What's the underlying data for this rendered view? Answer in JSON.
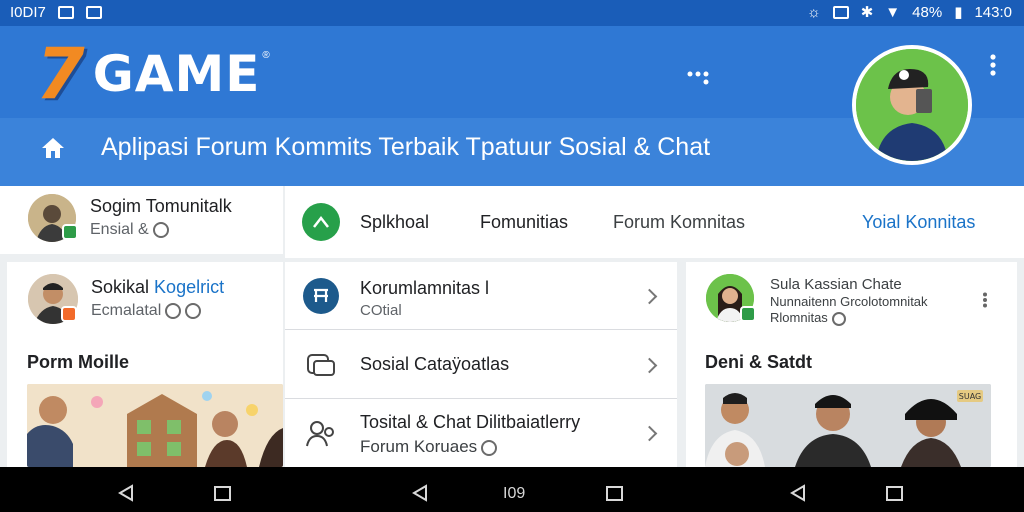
{
  "status_bar": {
    "time_left": "I0DI7",
    "battery": "48%",
    "time_right": "143:0"
  },
  "header": {
    "logo_mark": "7",
    "logo_text": "GAME",
    "logo_reg": "®",
    "tagline": "Aplipasi Forum Kommits Terbaik Tpatuur Sosial & Chat"
  },
  "left_top_card": {
    "name": "Sogim Tomunitalk",
    "sub": "Ensial &"
  },
  "tabs": [
    {
      "label": "Splkhoal",
      "active": false
    },
    {
      "label": "Fomunitias",
      "active": false
    },
    {
      "label": "Forum Komnitas",
      "active": false
    },
    {
      "label": "Yoial Konnitas",
      "active": true
    }
  ],
  "left_card": {
    "name_part1": "Sokikal",
    "name_part2": "Kogelrict",
    "sub": "Ecmalatal",
    "section_title": "Porm Moille"
  },
  "list": {
    "rows": [
      {
        "title": "Korumlamnitas l",
        "sub": "COtial",
        "icon": "forum-icon"
      },
      {
        "title": "Sosial Cataÿoatlas",
        "sub": "",
        "icon": "chat-icon"
      },
      {
        "title": "Tosital & Chat Dilitbaiatlerry",
        "sub": "Forum Koruaes",
        "icon": "people-icon"
      }
    ]
  },
  "right_card": {
    "name": "Sula Kassian Chate",
    "sub1": "Nunnaitenn Grcolotomnitak",
    "sub2": "Rlomnitas",
    "section_title": "Deni & Satdt",
    "photo_tag": "SUAG"
  },
  "nav_bar": {
    "center_label": "I09"
  },
  "colors": {
    "header_blue": "#2f78d4",
    "accent_blue": "#1a73c8",
    "green": "#27a04a",
    "orange_logo": "#f28a22"
  }
}
